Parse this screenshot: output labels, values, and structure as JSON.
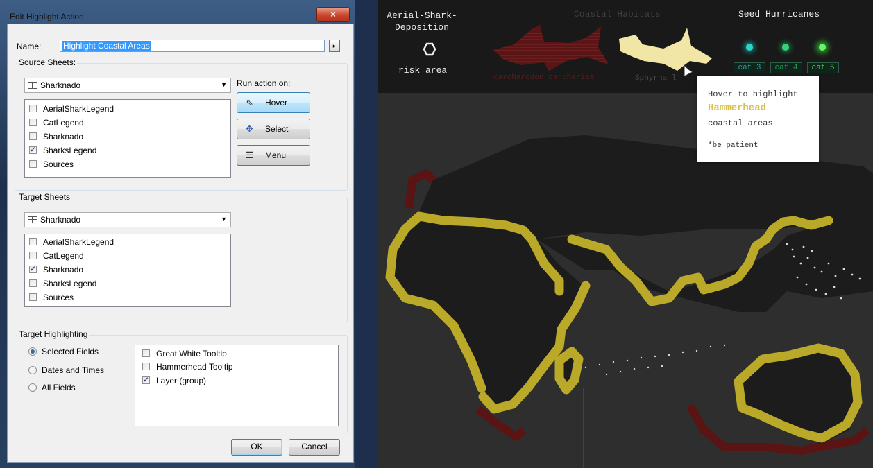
{
  "dialog": {
    "title": "Edit Highlight Action",
    "close_glyph": "×",
    "name_label": "Name:",
    "name_value": "Highlight Coastal Areas",
    "name_menu_glyph": "▸",
    "source": {
      "title": "Source Sheets:",
      "selected_sheet": "Sharknado",
      "items": [
        {
          "label": "AerialSharkLegend",
          "checked": false
        },
        {
          "label": "CatLegend",
          "checked": false
        },
        {
          "label": "Sharknado",
          "checked": false
        },
        {
          "label": "SharksLegend",
          "checked": true
        },
        {
          "label": "Sources",
          "checked": false
        }
      ]
    },
    "run_action": {
      "label": "Run action on:",
      "hover_label": "Hover",
      "select_label": "Select",
      "menu_label": "Menu"
    },
    "target": {
      "title": "Target Sheets",
      "selected_sheet": "Sharknado",
      "items": [
        {
          "label": "AerialSharkLegend",
          "checked": false
        },
        {
          "label": "CatLegend",
          "checked": false
        },
        {
          "label": "Sharknado",
          "checked": true
        },
        {
          "label": "SharksLegend",
          "checked": false
        },
        {
          "label": "Sources",
          "checked": false
        }
      ]
    },
    "highlighting": {
      "title": "Target Highlighting",
      "options": [
        {
          "label": "Selected Fields",
          "selected": true
        },
        {
          "label": "Dates and Times",
          "selected": false
        },
        {
          "label": "All Fields",
          "selected": false
        }
      ],
      "fields": [
        {
          "label": "Great White Tooltip",
          "checked": false
        },
        {
          "label": "Hammerhead Tooltip",
          "checked": false
        },
        {
          "label": "Layer (group)",
          "checked": true
        }
      ]
    },
    "ok_label": "OK",
    "cancel_label": "Cancel"
  },
  "viz": {
    "legend_title_line1": "Aerial-Shark-",
    "legend_title_line2": "Deposition",
    "risk_label": "risk area",
    "habitats_title": "Coastal Habitats",
    "species_great_white": "carcharodon carcharias",
    "species_hammerhead": "Sphyrna l",
    "seed_title": "Seed Hurricanes",
    "categories": [
      {
        "label": "cat 3",
        "color": "#17a4a4",
        "orb": "#2fd3c6"
      },
      {
        "label": "cat 4",
        "color": "#1c9a58",
        "orb": "#38d07b"
      },
      {
        "label": "cat 5",
        "color": "#3ddc3d",
        "orb": "#6af36a"
      }
    ],
    "tooltip": {
      "line1": "Hover to highlight",
      "species": "Hammerhead",
      "line3": "coastal areas",
      "note": "*be patient"
    },
    "colors": {
      "highlight_coast": "#c8b42a",
      "great_white_shark": "#6e1a1a",
      "hammerhead_shark": "#f1e6a6",
      "land": "#1e1e1e",
      "ocean": "#2e2e2e"
    }
  }
}
